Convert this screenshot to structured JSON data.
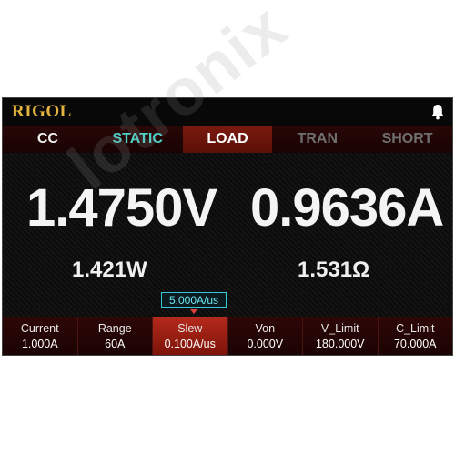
{
  "header": {
    "logo": "RIGOL",
    "bell_icon": "bell-icon"
  },
  "tabs": [
    {
      "label": "CC",
      "state": "normal"
    },
    {
      "label": "STATIC",
      "state": "highlight"
    },
    {
      "label": "LOAD",
      "state": "active"
    },
    {
      "label": "TRAN",
      "state": "dim"
    },
    {
      "label": "SHORT",
      "state": "dim"
    }
  ],
  "readings": {
    "voltage": "1.4750V",
    "current": "0.9636A",
    "power": "1.421W",
    "resistance": "1.531Ω"
  },
  "edit_box": {
    "value": "5.000A/us"
  },
  "params": [
    {
      "label": "Current",
      "value": "1.000A"
    },
    {
      "label": "Range",
      "value": "60A"
    },
    {
      "label": "Slew",
      "value": "0.100A/us",
      "selected": true
    },
    {
      "label": "Von",
      "value": "0.000V"
    },
    {
      "label": "V_Limit",
      "value": "180.000V"
    },
    {
      "label": "C_Limit",
      "value": "70.000A"
    }
  ],
  "watermark": "lotronix",
  "colors": {
    "logo": "#e2b33d",
    "static_tab": "#4fd0c8",
    "active_tab": "#7c1a10",
    "edit_box_border": "#36c7d8"
  }
}
